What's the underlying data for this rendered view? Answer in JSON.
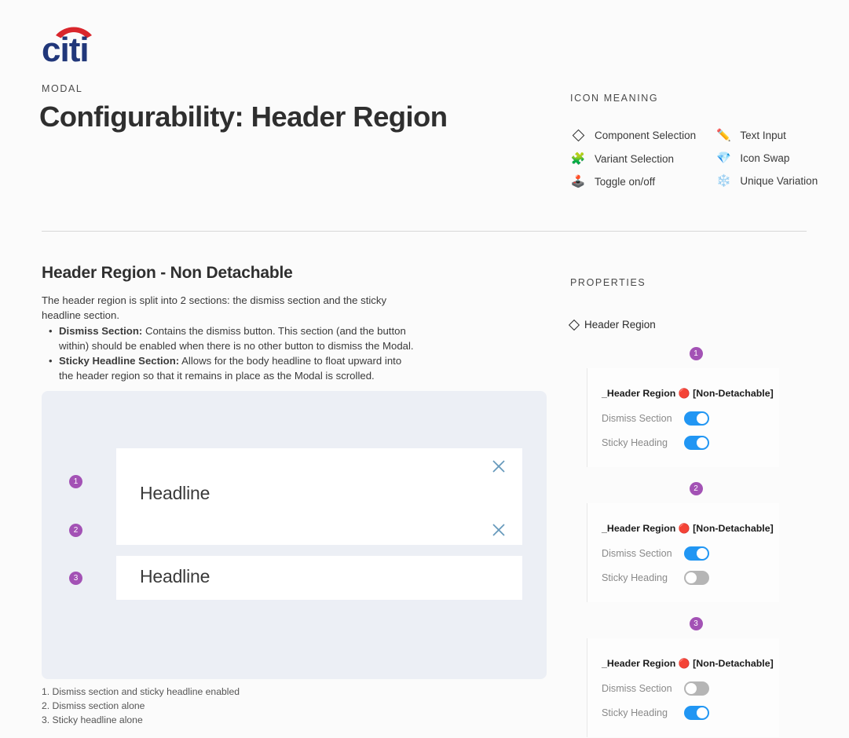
{
  "header": {
    "logo_alt": "citi",
    "brand_label": "MODAL",
    "title": "Configurability: Header Region"
  },
  "icon_meaning": {
    "kicker": "ICON MEANING",
    "left_items": [
      {
        "icon": "diamond-outline",
        "glyph": "",
        "label": "Component Selection"
      },
      {
        "icon": "puzzle-piece-icon",
        "glyph": "🧩",
        "label": "Variant Selection"
      },
      {
        "icon": "joystick-icon",
        "glyph": "🕹️",
        "label": "Toggle on/off"
      }
    ],
    "right_items": [
      {
        "icon": "pencil-icon",
        "glyph": "✏️",
        "label": "Text Input"
      },
      {
        "icon": "gem-icon",
        "glyph": "💎",
        "label": "Icon Swap"
      },
      {
        "icon": "snowflake-icon",
        "glyph": "❄️",
        "label": "Unique Variation"
      }
    ]
  },
  "main": {
    "sub_title": "Header Region - Non Detachable",
    "intro": "The header region is split into 2 sections: the dismiss section and the sticky headline section.",
    "bullets": [
      {
        "term": "Dismiss Section:",
        "text": " Contains the dismiss button. This section (and the button within) should be enabled when there is no other button to dismiss the Modal."
      },
      {
        "term": "Sticky Headline Section:",
        "text": " Allows for the body headline to float upward into the header region so that it remains in place as the Modal is scrolled."
      }
    ]
  },
  "demo": {
    "rows": [
      {
        "badge": "1",
        "headline": "Headline",
        "has_close": true,
        "has_headline": true
      },
      {
        "badge": "2",
        "headline": "",
        "has_close": true,
        "has_headline": false
      },
      {
        "badge": "3",
        "headline": "Headline",
        "has_close": false,
        "has_headline": true
      }
    ],
    "footnotes": [
      "1. Dismiss section and sticky headline enabled",
      "2. Dismiss section alone",
      "3. Sticky headline alone"
    ]
  },
  "properties": {
    "kicker": "PROPERTIES",
    "component_name": "Header Region",
    "groups": [
      {
        "badge": "1",
        "card_title_prefix": "_Header Region ",
        "card_title_dot": "🔴",
        "card_title_suffix": " [Non-Detachable]",
        "rows": [
          {
            "label": "Dismiss Section",
            "state": "on"
          },
          {
            "label": "Sticky Heading",
            "state": "on"
          }
        ]
      },
      {
        "badge": "2",
        "card_title_prefix": "_Header Region ",
        "card_title_dot": "🔴",
        "card_title_suffix": " [Non-Detachable]",
        "rows": [
          {
            "label": "Dismiss Section",
            "state": "on"
          },
          {
            "label": "Sticky Heading",
            "state": "off"
          }
        ]
      },
      {
        "badge": "3",
        "card_title_prefix": "_Header Region ",
        "card_title_dot": "🔴",
        "card_title_suffix": " [Non-Detachable]",
        "rows": [
          {
            "label": "Dismiss Section",
            "state": "off"
          },
          {
            "label": "Sticky Heading",
            "state": "on"
          }
        ]
      }
    ]
  },
  "colors": {
    "badge_purple": "#a352b5",
    "toggle_on_blue": "#2196f3",
    "toggle_off_grey": "#b5b5b5",
    "canvas_bg": "#eceff5",
    "close_icon_blue": "#6699bb",
    "citi_navy": "#21377a",
    "citi_red": "#d9262c"
  }
}
